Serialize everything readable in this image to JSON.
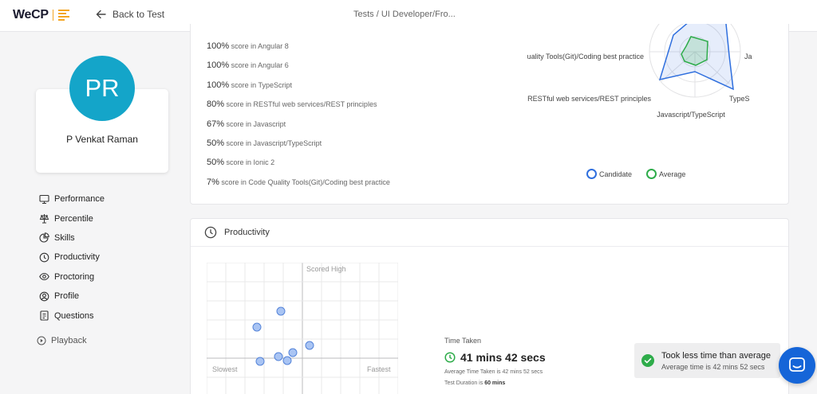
{
  "header": {
    "logo": "WeCP",
    "back_label": "Back to Test",
    "breadcrumb": "Tests / UI Developer/Fro..."
  },
  "profile": {
    "initials": "PR",
    "name": "P Venkat Raman"
  },
  "nav": [
    {
      "label": "Performance",
      "icon": "monitor-icon"
    },
    {
      "label": "Percentile",
      "icon": "scale-icon"
    },
    {
      "label": "Skills",
      "icon": "pie-chart-icon"
    },
    {
      "label": "Productivity",
      "icon": "clock-icon"
    },
    {
      "label": "Proctoring",
      "icon": "eye-icon"
    },
    {
      "label": "Profile",
      "icon": "user-circle-icon"
    },
    {
      "label": "Questions",
      "icon": "document-icon"
    }
  ],
  "playback_label": "Playback",
  "skills": {
    "rows": [
      {
        "pct": "100%",
        "text": "score in Angular 8"
      },
      {
        "pct": "100%",
        "text": "score in Angular 6"
      },
      {
        "pct": "100%",
        "text": "score in TypeScript"
      },
      {
        "pct": "80%",
        "text": "score in RESTful web services/REST principles"
      },
      {
        "pct": "67%",
        "text": "score in Javascript"
      },
      {
        "pct": "50%",
        "text": "score in Javascript/TypeScript"
      },
      {
        "pct": "50%",
        "text": "score in Ionic 2"
      },
      {
        "pct": "7%",
        "text": "score in Code Quality Tools(Git)/Coding best practice"
      }
    ],
    "radar_labels": {
      "left_top": "uality Tools(Git)/Coding best practice",
      "right_top": "Ja",
      "left_bottom": "RESTful web services/REST principles",
      "right_bottom": "TypeS",
      "bottom": "Javascript/TypeScript"
    },
    "legend": [
      {
        "label": "Candidate",
        "color": "#2f6fde"
      },
      {
        "label": "Average",
        "color": "#2eac4a"
      }
    ]
  },
  "productivity": {
    "title": "Productivity",
    "scatter": {
      "label_high": "Scored High",
      "label_slowest": "Slowest",
      "label_fastest": "Fastest",
      "point_color": "#9dbdf2"
    },
    "time_taken_label": "Time Taken",
    "time_taken_value": "41 mins 42 secs",
    "avg_prefix": "Average Time Taken is ",
    "avg_value": "42 mins 52 secs",
    "duration_prefix": "Test Duration is ",
    "duration_value": "60 mins",
    "toast_title": "Took less time than average",
    "toast_sub": "Average time is 42 mins 52 secs"
  }
}
